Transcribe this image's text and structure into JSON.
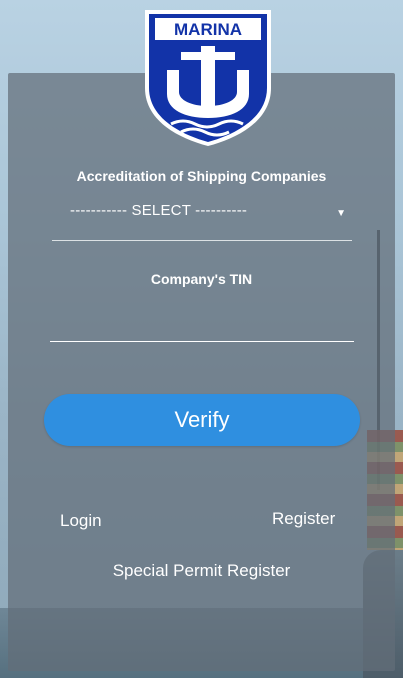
{
  "logo": {
    "text": "MARINA",
    "icon": "anchor-shield-icon",
    "colors": {
      "blue": "#1233a8",
      "white": "#ffffff"
    }
  },
  "form": {
    "title": "Accreditation of Shipping Companies",
    "select": {
      "selected": "----------- SELECT ----------"
    },
    "tin_label": "Company's TIN",
    "tin_value": "",
    "verify_label": "Verify"
  },
  "links": {
    "login": "Login",
    "register": "Register",
    "special_permit": "Special Permit Register"
  },
  "colors": {
    "button": "#2f8fe0",
    "panel": "#626e78"
  }
}
